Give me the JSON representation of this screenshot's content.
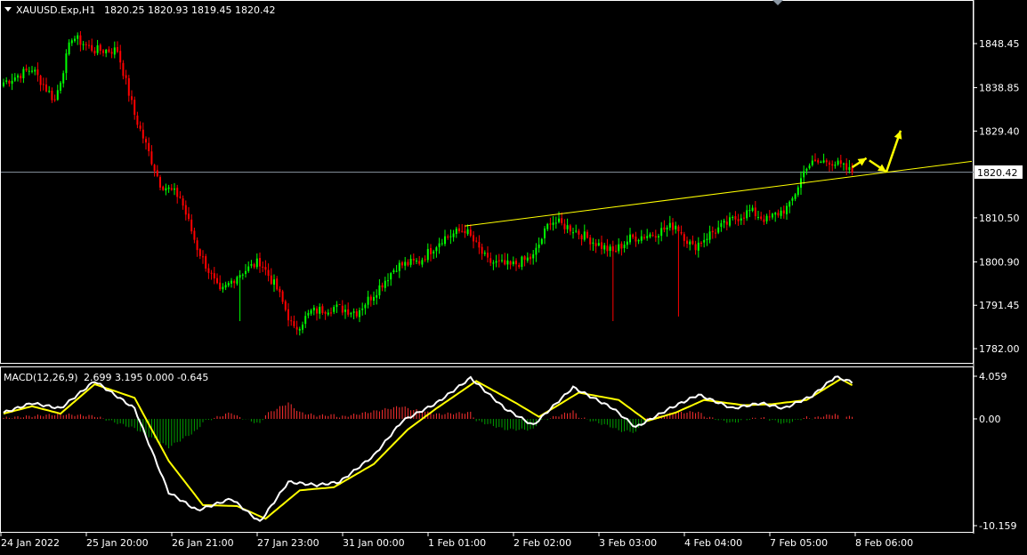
{
  "chart_header": {
    "symbol_timeframe": "XAUUSD.Exp,H1",
    "ohlc": "1820.25 1820.93 1819.45 1820.42"
  },
  "macd_header": {
    "label": "MACD(12,26,9)",
    "values": "2.699 3.195 0.000 -0.645"
  },
  "current_price_label": "1820.42",
  "colors": {
    "background": "#000000",
    "bull_candle": "#00ff00",
    "bear_candle": "#ff0000",
    "trendline": "#ffff00",
    "arrow": "#ffff00",
    "macd_line": "#ffffff",
    "signal_line": "#ffff00",
    "hist_positive": "#ff3030",
    "hist_negative": "#00a000",
    "price_line": "#8a96a3"
  },
  "chart_data": [
    {
      "type": "candlestick",
      "price_axis_ticks": [
        "1848.45",
        "1838.85",
        "1829.40",
        "1820.42",
        "1810.50",
        "1800.90",
        "1791.45",
        "1782.00"
      ],
      "current_price": 1820.42,
      "price_anchors": [
        {
          "index": 0,
          "close": 1840
        },
        {
          "index": 10,
          "close": 1843
        },
        {
          "index": 18,
          "close": 1836
        },
        {
          "index": 24,
          "close": 1850
        },
        {
          "index": 32,
          "close": 1847
        },
        {
          "index": 40,
          "close": 1847
        },
        {
          "index": 46,
          "close": 1833
        },
        {
          "index": 55,
          "close": 1818
        },
        {
          "index": 62,
          "close": 1815
        },
        {
          "index": 68,
          "close": 1804
        },
        {
          "index": 76,
          "close": 1794
        },
        {
          "index": 82,
          "close": 1798
        },
        {
          "index": 90,
          "close": 1801
        },
        {
          "index": 96,
          "close": 1795
        },
        {
          "index": 102,
          "close": 1786
        },
        {
          "index": 108,
          "close": 1790
        },
        {
          "index": 116,
          "close": 1791
        },
        {
          "index": 124,
          "close": 1790
        },
        {
          "index": 130,
          "close": 1794
        },
        {
          "index": 138,
          "close": 1800
        },
        {
          "index": 146,
          "close": 1801
        },
        {
          "index": 154,
          "close": 1806
        },
        {
          "index": 162,
          "close": 1808
        },
        {
          "index": 170,
          "close": 1801
        },
        {
          "index": 178,
          "close": 1800
        },
        {
          "index": 186,
          "close": 1802
        },
        {
          "index": 192,
          "close": 1810
        },
        {
          "index": 200,
          "close": 1808
        },
        {
          "index": 208,
          "close": 1805
        },
        {
          "index": 214,
          "close": 1803
        },
        {
          "index": 220,
          "close": 1806
        },
        {
          "index": 228,
          "close": 1807
        },
        {
          "index": 236,
          "close": 1809
        },
        {
          "index": 242,
          "close": 1804
        },
        {
          "index": 248,
          "close": 1807
        },
        {
          "index": 256,
          "close": 1810
        },
        {
          "index": 262,
          "close": 1812
        },
        {
          "index": 268,
          "close": 1810
        },
        {
          "index": 276,
          "close": 1813
        },
        {
          "index": 282,
          "close": 1822
        },
        {
          "index": 290,
          "close": 1823
        },
        {
          "index": 298,
          "close": 1820.42
        }
      ],
      "wick_spikes": [
        {
          "index": 83,
          "low": 1788
        },
        {
          "index": 214,
          "low": 1788
        },
        {
          "index": 237,
          "low": 1789
        },
        {
          "index": 118,
          "low": 1793
        }
      ],
      "trendline": {
        "start": {
          "index": 162,
          "price": 1808.7
        },
        "end": {
          "index": 340,
          "price": 1822.8
        }
      },
      "arrows": [
        {
          "from": {
            "index": 298,
            "price": 1821.5
          },
          "to": {
            "index": 303,
            "price": 1823.5
          }
        },
        {
          "from": {
            "index": 304,
            "price": 1823
          },
          "to": {
            "index": 310,
            "price": 1820.5
          }
        },
        {
          "from": {
            "index": 310,
            "price": 1820.5
          },
          "to": {
            "index": 315,
            "price": 1829.5
          }
        }
      ]
    },
    {
      "type": "macd",
      "range_labels": [
        "4.059",
        "0.00",
        "-10.159"
      ],
      "ylim": [
        -10.159,
        4.059
      ],
      "macd_anchors": [
        {
          "index": 0,
          "v": 0.6
        },
        {
          "index": 10,
          "v": 1.5
        },
        {
          "index": 20,
          "v": 1.0
        },
        {
          "index": 32,
          "v": 3.6
        },
        {
          "index": 46,
          "v": 1.0
        },
        {
          "index": 58,
          "v": -7
        },
        {
          "index": 68,
          "v": -8.7
        },
        {
          "index": 80,
          "v": -7.6
        },
        {
          "index": 90,
          "v": -9.8
        },
        {
          "index": 100,
          "v": -6.0
        },
        {
          "index": 110,
          "v": -6.3
        },
        {
          "index": 118,
          "v": -6.0
        },
        {
          "index": 130,
          "v": -3.5
        },
        {
          "index": 140,
          "v": -0.2
        },
        {
          "index": 152,
          "v": 1.5
        },
        {
          "index": 164,
          "v": 3.9
        },
        {
          "index": 176,
          "v": 1.0
        },
        {
          "index": 186,
          "v": -0.6
        },
        {
          "index": 200,
          "v": 3.0
        },
        {
          "index": 214,
          "v": 1.0
        },
        {
          "index": 222,
          "v": -0.8
        },
        {
          "index": 234,
          "v": 1.0
        },
        {
          "index": 244,
          "v": 2.3
        },
        {
          "index": 256,
          "v": 1.0
        },
        {
          "index": 266,
          "v": 1.5
        },
        {
          "index": 274,
          "v": 1.0
        },
        {
          "index": 284,
          "v": 2.2
        },
        {
          "index": 292,
          "v": 4.0
        },
        {
          "index": 298,
          "v": 3.5
        }
      ],
      "signal_anchors": [
        {
          "index": 0,
          "v": 0.5
        },
        {
          "index": 10,
          "v": 1.2
        },
        {
          "index": 20,
          "v": 0.5
        },
        {
          "index": 32,
          "v": 3.3
        },
        {
          "index": 46,
          "v": 2.0
        },
        {
          "index": 58,
          "v": -4
        },
        {
          "index": 70,
          "v": -8.2
        },
        {
          "index": 82,
          "v": -8.3
        },
        {
          "index": 92,
          "v": -9.5
        },
        {
          "index": 104,
          "v": -6.8
        },
        {
          "index": 116,
          "v": -6.5
        },
        {
          "index": 130,
          "v": -4.3
        },
        {
          "index": 142,
          "v": -1.0
        },
        {
          "index": 152,
          "v": 1.0
        },
        {
          "index": 166,
          "v": 3.6
        },
        {
          "index": 180,
          "v": 1.5
        },
        {
          "index": 188,
          "v": 0.2
        },
        {
          "index": 202,
          "v": 2.5
        },
        {
          "index": 216,
          "v": 1.8
        },
        {
          "index": 226,
          "v": -0.2
        },
        {
          "index": 236,
          "v": 0.6
        },
        {
          "index": 246,
          "v": 1.8
        },
        {
          "index": 260,
          "v": 1.3
        },
        {
          "index": 270,
          "v": 1.4
        },
        {
          "index": 282,
          "v": 1.8
        },
        {
          "index": 294,
          "v": 3.8
        },
        {
          "index": 298,
          "v": 3.2
        }
      ]
    }
  ],
  "time_axis_labels": [
    "24 Jan 2022",
    "25 Jan 20:00",
    "26 Jan 21:00",
    "27 Jan 23:00",
    "31 Jan 00:00",
    "1 Feb 01:00",
    "2 Feb 02:00",
    "3 Feb 03:00",
    "4 Feb 04:00",
    "7 Feb 05:00",
    "8 Feb 06:00"
  ]
}
